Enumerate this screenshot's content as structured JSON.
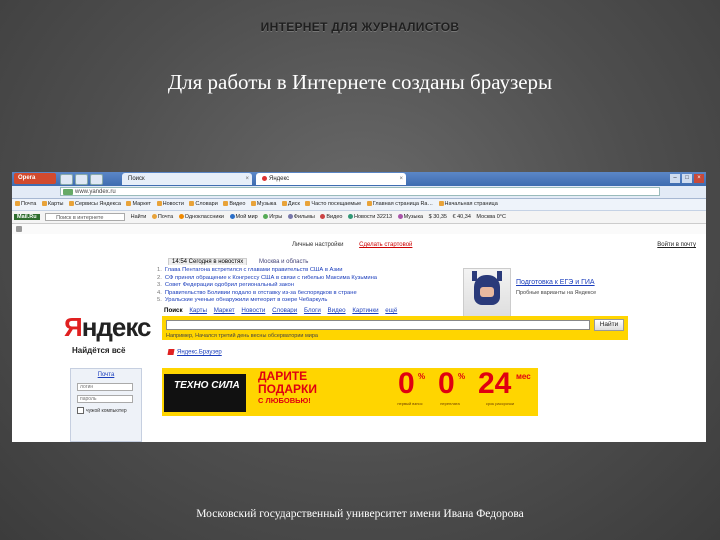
{
  "slide": {
    "title": "ИНТЕРНЕТ ДЛЯ ЖУРНАЛИСТОВ",
    "heading": "Для работы в Интернете созданы браузеры",
    "footer": "Московский государственный университет имени Ивана Федорова"
  },
  "browser": {
    "menu_label": "Opera",
    "tabs": [
      {
        "label": "Поиск"
      },
      {
        "label": "Яндекс"
      }
    ],
    "address": "www.yandex.ru",
    "bookmarks": [
      "Почта",
      "Карты",
      "Сервисы Яндекса",
      "Маркет",
      "Новости",
      "Словари",
      "Видео",
      "Музыка",
      "Диск",
      "Часто посещаемые",
      "Главная страница Ra…",
      "Начальная страница"
    ],
    "toolbar": {
      "mail": "Mail.Ru",
      "search_placeholder": "Поиск в интернете",
      "items": [
        "Найти",
        "Почта",
        "Одноклассники",
        "Мой мир",
        "Игры",
        "Фильмы",
        "Видео",
        "Новости 32213",
        "Музыка",
        "$ 30,35",
        "€ 40,34",
        "Москва 0°C"
      ]
    }
  },
  "yandex": {
    "top_links": [
      "Личные настройки",
      "Сделать стартовой"
    ],
    "login_link": "Войти в почту",
    "news_tabs": [
      "14:54 Сегодня в новостях",
      "Москва и область"
    ],
    "news": [
      "Глава Пентагона встретился с главами правительств США в Азии",
      "СФ принял обращение к Конгрессу США в связи с гибелью Максима Кузьмина",
      "Совет Федерации одобрил региональный закон",
      "Правительство Боливии подало в отставку из-за беспорядков в стране",
      "Уральские ученые обнаружили метеорит в озере Чебаркуль"
    ],
    "promo": {
      "title": "Подготовка к ЕГЭ и ГИА",
      "subtitle": "Пробные варианты на Яндексе"
    },
    "logo": "Яндекс",
    "tagline": "Найдётся всё",
    "sections": [
      "Поиск",
      "Карты",
      "Маркет",
      "Новости",
      "Словари",
      "Блоги",
      "Видео",
      "Картинки",
      "ещё"
    ],
    "search_button": "Найти",
    "search_hint": "Например, Начался третий день весны обсерватории мира",
    "favorites": [
      "Яндекс.Браузер"
    ],
    "login": {
      "title": "Почта",
      "login_placeholder": "логин",
      "password_placeholder": "пароль",
      "remember": "чужой компьютер"
    }
  },
  "ad": {
    "brand": "ТЕХНО СИЛА",
    "line1": "ДАРИТЕ",
    "line2": "ПОДАРКИ",
    "line3": "С ЛЮБОВЬЮ!",
    "offers": [
      {
        "value": "0",
        "unit": "%",
        "caption": "первый взнос"
      },
      {
        "value": "0",
        "unit": "%",
        "caption": "переплата"
      },
      {
        "value": "24",
        "unit": "мес",
        "caption": "срок рассрочки"
      }
    ]
  },
  "colors": {
    "yandex_red": "#e02020",
    "search_yellow": "#ffd500",
    "link_blue": "#1a3dbc",
    "slide_bg": "#4e4e4e"
  }
}
